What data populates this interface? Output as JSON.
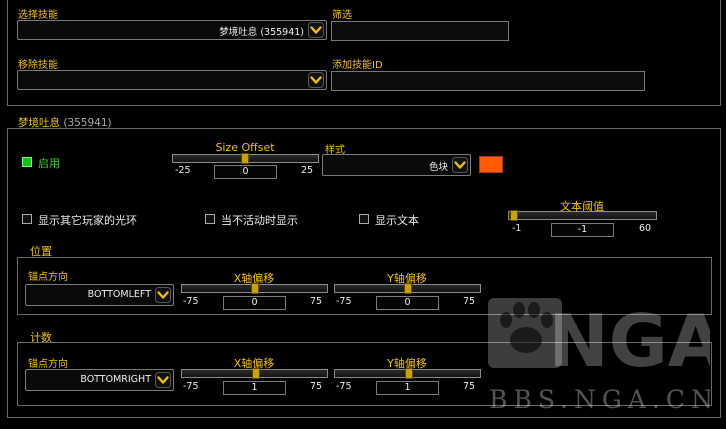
{
  "top": {
    "select_skill_label": "选择技能",
    "select_skill_value": "梦境吐息 (355941)",
    "filter_label": "筛选",
    "filter_value": "",
    "remove_skill_label": "移除技能",
    "remove_skill_value": "",
    "add_skill_label": "添加技能ID",
    "add_skill_value": ""
  },
  "skill": {
    "title_main": "梦境吐息",
    "title_id": "(355941)",
    "enabled_label": "启用",
    "enabled": true,
    "size_offset": {
      "label": "Size Offset",
      "min": "-25",
      "max": "25",
      "value": "0",
      "level": 0.5
    },
    "style_label": "样式",
    "style_value": "色块",
    "style_color": "#ff5a00",
    "show_others_label": "显示其它玩家的光环",
    "show_inactive_label": "当不活动时显示",
    "show_text_label": "显示文本",
    "text_threshold": {
      "label": "文本阈值",
      "min": "-1",
      "max": "60",
      "value": "-1",
      "level": 0.0
    }
  },
  "position": {
    "section_label": "位置",
    "anchor_label": "锚点方向",
    "anchor_value": "BOTTOMLEFT",
    "x_offset": {
      "label": "X轴偏移",
      "min": "-75",
      "max": "75",
      "value": "0",
      "level": 0.5
    },
    "y_offset": {
      "label": "Y轴偏移",
      "min": "-75",
      "max": "75",
      "value": "0",
      "level": 0.5
    }
  },
  "count": {
    "section_label": "计数",
    "anchor_label": "锚点方向",
    "anchor_value": "BOTTOMRIGHT",
    "x_offset": {
      "label": "X轴偏移",
      "min": "-75",
      "max": "75",
      "value": "1",
      "level": 0.507
    },
    "y_offset": {
      "label": "Y轴偏移",
      "min": "-75",
      "max": "75",
      "value": "1",
      "level": 0.507
    }
  },
  "watermark": {
    "logo": "NGA",
    "url": "BBS.NGA.CN"
  },
  "colors": {
    "accent": "#f0c000",
    "enabled_green": "#18c018"
  }
}
